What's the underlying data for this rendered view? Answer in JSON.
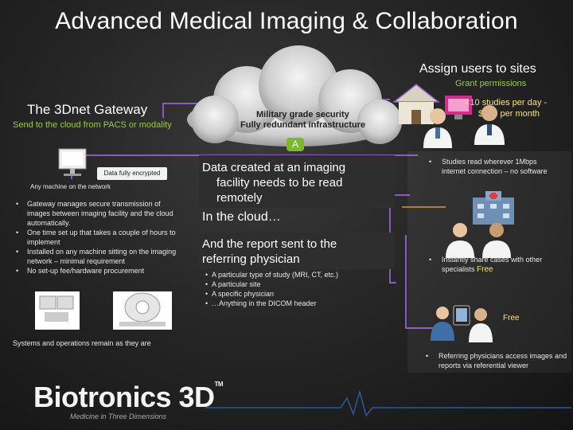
{
  "title": "Advanced Medical Imaging & Collaboration",
  "gateway": {
    "title": "The 3Dnet Gateway",
    "subtitle": "Send to the cloud from PACS or modality",
    "encrypted_label": "Data fully encrypted",
    "any_machine_label": "Any machine on the network",
    "bullets": [
      "Gateway manages secure transmission of images between imaging facility and the cloud automatically.",
      "One time set up that takes a couple of hours to implement",
      "Installed on any machine sitting on the imaging network – minimal requirement",
      "No set-up fee/hardware procurement"
    ],
    "systems_note": "Systems and operations remain as they are"
  },
  "cloud": {
    "security_line1": "Military grade security",
    "security_line2": "Fully redundant infrastructure",
    "badge": "A"
  },
  "center": {
    "read_line1": "Data created at an imaging",
    "read_line2": "facility needs to be read",
    "read_line3": "remotely",
    "in_cloud": "In the cloud…",
    "report_line1": "And the report sent to the",
    "report_line2": "referring physician",
    "conditions": [
      "A particular type of study (MRI, CT, etc.)",
      "A particular site",
      "A specific physician",
      "…Anything in the DICOM header"
    ]
  },
  "sites": {
    "assign": "Assign users to sites",
    "grant": "Grant permissions",
    "price_line1": "<10 studies per day -",
    "price_line2": "$250 per month"
  },
  "right": {
    "bullet1": "Studies read wherever 1Mbps internet connection – no software",
    "bullet2": "Instantly share cases with other specialists",
    "free1": "Free",
    "free2": "Free",
    "bullet3": "Referring physicians access images and reports via referential viewer"
  },
  "bullet_char": "•",
  "brand": {
    "name": "Biotronics 3D",
    "mark": "TM",
    "tagline": "Medicine in Three Dimensions"
  },
  "colors": {
    "accent_green": "#9fc93c",
    "price_yellow": "#f7e36a",
    "link_purple": "#8a5bbf",
    "link_orange": "#e0902e"
  }
}
